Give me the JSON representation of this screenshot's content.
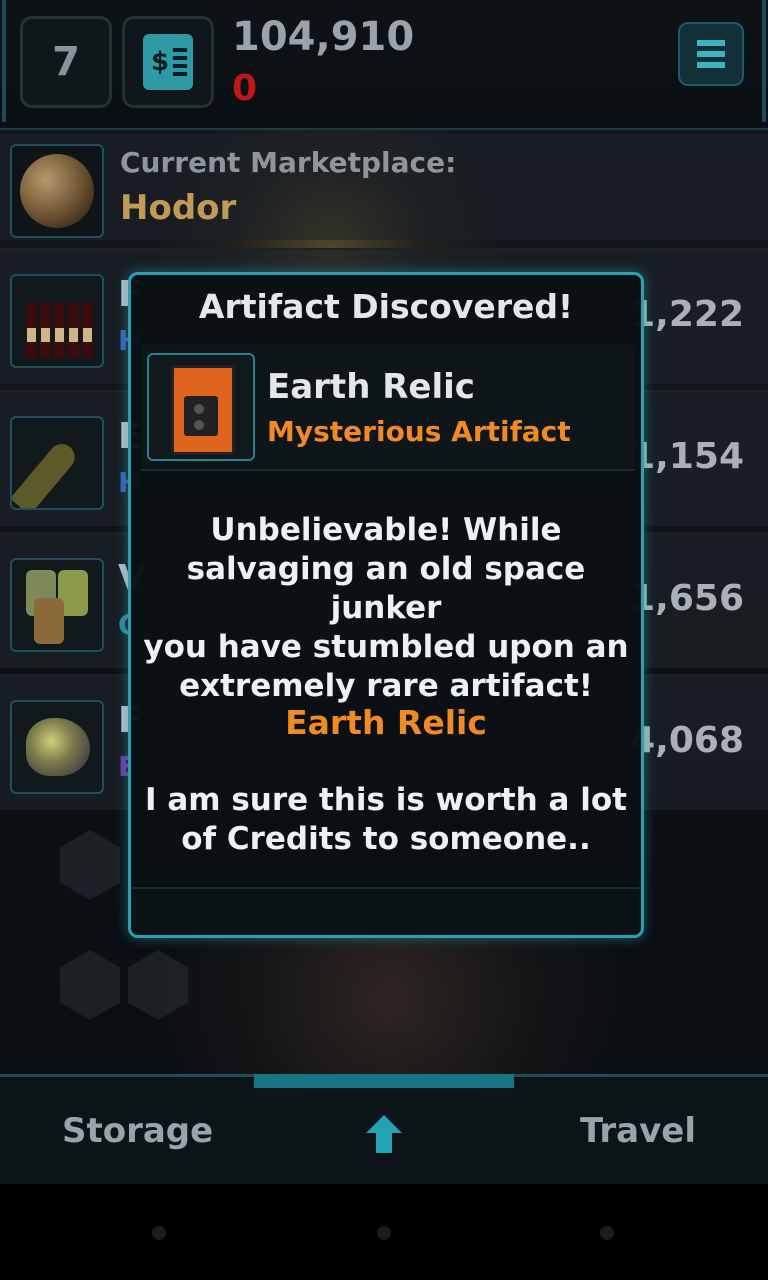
{
  "header": {
    "level": "7",
    "cash_icon": "cash-register-icon",
    "credits": "104,910",
    "debt": "0",
    "menu_icon": "hamburger-menu-icon"
  },
  "marketplace": {
    "label": "Current Marketplace:",
    "name": "Hodor"
  },
  "trade_items": [
    {
      "initial": "F",
      "sub": "H",
      "sub_color": "#3a5fb8",
      "price": "1,222",
      "icon": "wine-bottles-icon"
    },
    {
      "initial": "E",
      "sub": "H",
      "sub_color": "#3a5fb8",
      "price": "1,154",
      "icon": "shell-casing-icon"
    },
    {
      "initial": "V",
      "sub": "C",
      "sub_color": "#2b8a9a",
      "price": "1,656",
      "icon": "barrels-icon"
    },
    {
      "initial": "F",
      "sub": "E",
      "sub_color": "#6d3aa8",
      "price": "4,068",
      "icon": "ore-rock-icon"
    }
  ],
  "modal": {
    "title": "Artifact Discovered!",
    "item_name": "Earth Relic",
    "item_type": "Mysterious Artifact",
    "item_icon": "cassette-player-icon",
    "message_lines": [
      "Unbelievable! While",
      "salvaging an old space junker",
      "you have stumbled upon an",
      "extremely rare artifact!"
    ],
    "highlight": "Earth Relic",
    "message2_lines": [
      "I am sure this is worth a lot",
      "of Credits to someone.."
    ]
  },
  "bottom_nav": {
    "storage_label": "Storage",
    "travel_label": "Travel",
    "arrow_icon": "up-arrow-icon"
  },
  "colors": {
    "accent": "#2aa0b4",
    "highlight": "#f08a24",
    "marketplace_name": "#c29a56",
    "debt": "#c01818"
  }
}
